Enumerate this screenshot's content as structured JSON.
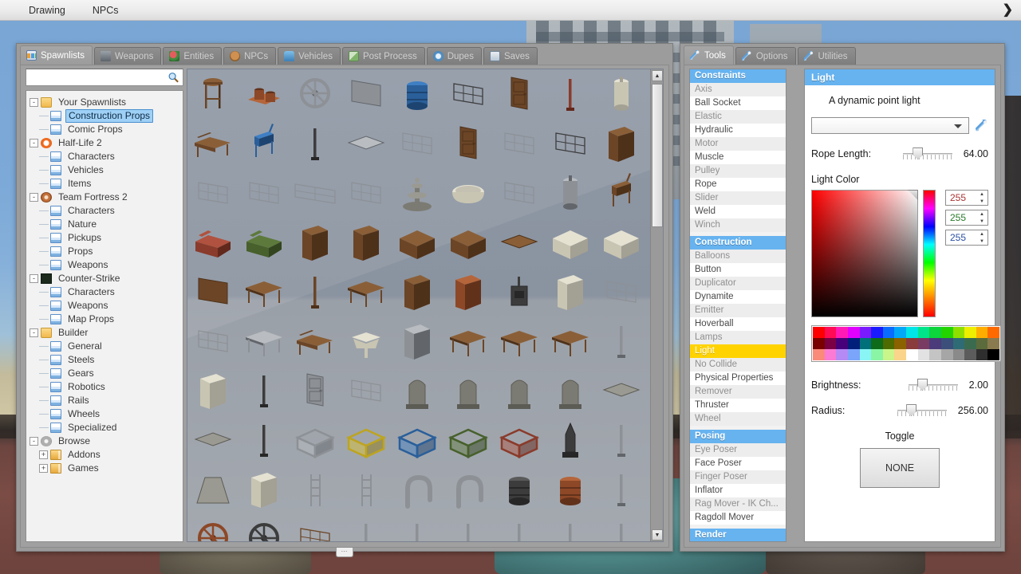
{
  "menubar": {
    "items": [
      {
        "label": "Drawing",
        "name": "menu-drawing"
      },
      {
        "label": "NPCs",
        "name": "menu-npcs"
      }
    ],
    "arrow": "❯"
  },
  "spawnmenu": {
    "tabs": [
      {
        "label": "Spawnlists",
        "icon": "spawnlists-icon",
        "active": true
      },
      {
        "label": "Weapons",
        "icon": "weapons-icon",
        "active": false
      },
      {
        "label": "Entities",
        "icon": "entities-icon",
        "active": false
      },
      {
        "label": "NPCs",
        "icon": "npcs-icon",
        "active": false
      },
      {
        "label": "Vehicles",
        "icon": "vehicles-icon",
        "active": false
      },
      {
        "label": "Post Process",
        "icon": "post-process-icon",
        "active": false
      },
      {
        "label": "Dupes",
        "icon": "dupes-icon",
        "active": false
      },
      {
        "label": "Saves",
        "icon": "saves-icon",
        "active": false
      }
    ],
    "search": {
      "value": "",
      "placeholder": ""
    },
    "tree": [
      {
        "label": "Your Spawnlists",
        "depth": 0,
        "icon": "folder",
        "toggle": "-",
        "selected": false
      },
      {
        "label": "Construction Props",
        "depth": 1,
        "icon": "doc",
        "toggle": "",
        "selected": true
      },
      {
        "label": "Comic Props",
        "depth": 1,
        "icon": "doc",
        "toggle": "",
        "selected": false
      },
      {
        "label": "Half-Life 2",
        "depth": 0,
        "icon": "hl2",
        "toggle": "-",
        "selected": false
      },
      {
        "label": "Characters",
        "depth": 1,
        "icon": "doc",
        "toggle": "",
        "selected": false
      },
      {
        "label": "Vehicles",
        "depth": 1,
        "icon": "doc",
        "toggle": "",
        "selected": false
      },
      {
        "label": "Items",
        "depth": 1,
        "icon": "doc",
        "toggle": "",
        "selected": false
      },
      {
        "label": "Team Fortress 2",
        "depth": 0,
        "icon": "tf2",
        "toggle": "-",
        "selected": false
      },
      {
        "label": "Characters",
        "depth": 1,
        "icon": "doc",
        "toggle": "",
        "selected": false
      },
      {
        "label": "Nature",
        "depth": 1,
        "icon": "doc",
        "toggle": "",
        "selected": false
      },
      {
        "label": "Pickups",
        "depth": 1,
        "icon": "doc",
        "toggle": "",
        "selected": false
      },
      {
        "label": "Props",
        "depth": 1,
        "icon": "doc",
        "toggle": "",
        "selected": false
      },
      {
        "label": "Weapons",
        "depth": 1,
        "icon": "doc",
        "toggle": "",
        "selected": false
      },
      {
        "label": "Counter-Strike",
        "depth": 0,
        "icon": "cs",
        "toggle": "-",
        "selected": false
      },
      {
        "label": "Characters",
        "depth": 1,
        "icon": "doc",
        "toggle": "",
        "selected": false
      },
      {
        "label": "Weapons",
        "depth": 1,
        "icon": "doc",
        "toggle": "",
        "selected": false
      },
      {
        "label": "Map Props",
        "depth": 1,
        "icon": "doc",
        "toggle": "",
        "selected": false
      },
      {
        "label": "Builder",
        "depth": 0,
        "icon": "folder",
        "toggle": "-",
        "selected": false
      },
      {
        "label": "General",
        "depth": 1,
        "icon": "doc",
        "toggle": "",
        "selected": false
      },
      {
        "label": "Steels",
        "depth": 1,
        "icon": "doc",
        "toggle": "",
        "selected": false
      },
      {
        "label": "Gears",
        "depth": 1,
        "icon": "doc",
        "toggle": "",
        "selected": false
      },
      {
        "label": "Robotics",
        "depth": 1,
        "icon": "doc",
        "toggle": "",
        "selected": false
      },
      {
        "label": "Rails",
        "depth": 1,
        "icon": "doc",
        "toggle": "",
        "selected": false
      },
      {
        "label": "Wheels",
        "depth": 1,
        "icon": "doc",
        "toggle": "",
        "selected": false
      },
      {
        "label": "Specialized",
        "depth": 1,
        "icon": "doc",
        "toggle": "",
        "selected": false
      },
      {
        "label": "Browse",
        "depth": 0,
        "icon": "gear",
        "toggle": "-",
        "selected": false
      },
      {
        "label": "Addons",
        "depth": 1,
        "icon": "addon",
        "toggle": "+",
        "selected": false
      },
      {
        "label": "Games",
        "depth": 1,
        "icon": "addon",
        "toggle": "+",
        "selected": false
      }
    ],
    "grid": {
      "rows": [
        [
          "barstool",
          "paint-cans",
          "flywheel",
          "metal-panel",
          "blue-barrel",
          "window-bars",
          "wood-door",
          "fire-hydrant",
          "propane-tank"
        ],
        [
          "wood-bench",
          "blue-chair",
          "metal-post",
          "metal-plate",
          "air-vent",
          "wood-door-2",
          "metal-grate",
          "metal-fence",
          "tall-cabinet"
        ],
        [
          "chain-fence",
          "chain-fence-2",
          "chain-fence-long",
          "chain-fence-small",
          "fountain",
          "bathtub",
          "metal-rack",
          "water-heater",
          "wood-chair"
        ],
        [
          "red-couch",
          "green-couch",
          "wood-cabinet",
          "dresser",
          "wood-drawer",
          "wood-crate",
          "wood-plank",
          "mattress",
          "mattress-2"
        ],
        [
          "wood-panel",
          "coffee-table",
          "wood-pole",
          "work-desk",
          "narrow-shelf",
          "tall-shelf",
          "wood-stove",
          "refrigerator",
          "radiator"
        ],
        [
          "radiator-2",
          "glass-table",
          "park-bench",
          "sink",
          "stove",
          "round-table",
          "long-table",
          "picnic-table",
          "pipe-small"
        ],
        [
          "washing-machine",
          "lamp-post",
          "metal-door",
          "window-frame",
          "gravestone",
          "gravestone-2",
          "gravestone-3",
          "gravestone-4",
          "grave-slab"
        ],
        [
          "grave-slab-2",
          "statue-base",
          "cage-gray",
          "cage-yellow",
          "cage-blue",
          "cage-green",
          "cage-red",
          "obelisk",
          "hook"
        ],
        [
          "lampshade",
          "lockers",
          "ladder",
          "ladder-2",
          "pipe-bent",
          "pipe-bent-2",
          "oil-drum",
          "rusty-drum",
          "hook-2"
        ],
        [
          "valve-wheel",
          "valve-wheel-2",
          "wood-vent",
          "pole",
          "antenna",
          "antenna-2",
          "antenna-3",
          "antenna-4",
          "pole-2"
        ]
      ],
      "scrollbar": {
        "up": "▲",
        "down": "▼"
      }
    },
    "grip": "⋯"
  },
  "toolmenu": {
    "tabs": [
      {
        "label": "Tools",
        "active": true
      },
      {
        "label": "Options",
        "active": false
      },
      {
        "label": "Utilities",
        "active": false
      }
    ],
    "toollist": [
      {
        "label": "Constraints",
        "type": "header"
      },
      {
        "label": "Axis",
        "type": "item"
      },
      {
        "label": "Ball Socket",
        "type": "item"
      },
      {
        "label": "Elastic",
        "type": "item"
      },
      {
        "label": "Hydraulic",
        "type": "item"
      },
      {
        "label": "Motor",
        "type": "item"
      },
      {
        "label": "Muscle",
        "type": "item"
      },
      {
        "label": "Pulley",
        "type": "item"
      },
      {
        "label": "Rope",
        "type": "item"
      },
      {
        "label": "Slider",
        "type": "item"
      },
      {
        "label": "Weld",
        "type": "item"
      },
      {
        "label": "Winch",
        "type": "item"
      },
      {
        "label": "",
        "type": "gap"
      },
      {
        "label": "Construction",
        "type": "header"
      },
      {
        "label": "Balloons",
        "type": "item"
      },
      {
        "label": "Button",
        "type": "item"
      },
      {
        "label": "Duplicator",
        "type": "item"
      },
      {
        "label": "Dynamite",
        "type": "item"
      },
      {
        "label": "Emitter",
        "type": "item"
      },
      {
        "label": "Hoverball",
        "type": "item"
      },
      {
        "label": "Lamps",
        "type": "item"
      },
      {
        "label": "Light",
        "type": "selected"
      },
      {
        "label": "No Collide",
        "type": "item"
      },
      {
        "label": "Physical Properties",
        "type": "item"
      },
      {
        "label": "Remover",
        "type": "item"
      },
      {
        "label": "Thruster",
        "type": "item"
      },
      {
        "label": "Wheel",
        "type": "item"
      },
      {
        "label": "",
        "type": "gap"
      },
      {
        "label": "Posing",
        "type": "header"
      },
      {
        "label": "Eye Poser",
        "type": "item"
      },
      {
        "label": "Face Poser",
        "type": "item"
      },
      {
        "label": "Finger Poser",
        "type": "item"
      },
      {
        "label": "Inflator",
        "type": "item"
      },
      {
        "label": "Rag Mover - IK Ch...",
        "type": "item"
      },
      {
        "label": "Ragdoll Mover",
        "type": "item"
      },
      {
        "label": "",
        "type": "gap"
      },
      {
        "label": "Render",
        "type": "header"
      }
    ],
    "light": {
      "title": "Light",
      "description": "A dynamic point light",
      "model_select_value": "",
      "rope_length_label": "Rope Length:",
      "rope_length_value": "64.00",
      "rope_length_pct": 30,
      "color_label": "Light Color",
      "rgb": {
        "r": "255",
        "g": "255",
        "b": "255"
      },
      "palette": [
        "#ff0000",
        "#ff0a55",
        "#ff1ab5",
        "#e000ff",
        "#7a1aff",
        "#1a1aff",
        "#0a6bff",
        "#00a8f5",
        "#00e5e5",
        "#00e58a",
        "#0bd43c",
        "#23d400",
        "#8fe000",
        "#eeee00",
        "#ffae00",
        "#ff6a00",
        "#7a0000",
        "#7a0043",
        "#46007a",
        "#001f7a",
        "#00707a",
        "#0d6b1a",
        "#4d6b00",
        "#8a6200",
        "#8a3b3b",
        "#7a3b62",
        "#4b3b7a",
        "#3b4f7a",
        "#2f6b75",
        "#3b6b4f",
        "#5c6b3b",
        "#8a7a4f",
        "#fa8a7a",
        "#fa7ad4",
        "#b58af5",
        "#7aa5fa",
        "#8af5f5",
        "#8af5a5",
        "#c9f58a",
        "#fad48a",
        "#ffffff",
        "#e2e2e2",
        "#c4c4c4",
        "#a6a6a6",
        "#8a8a8a",
        "#5c5c5c",
        "#2e2e2e",
        "#000000"
      ],
      "brightness_label": "Brightness:",
      "brightness_value": "2.00",
      "brightness_pct": 28,
      "radius_label": "Radius:",
      "radius_value": "256.00",
      "radius_pct": 28,
      "toggle_label": "Toggle",
      "toggle_button": "NONE"
    }
  }
}
